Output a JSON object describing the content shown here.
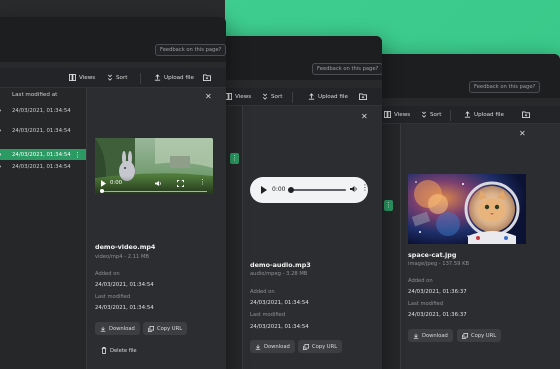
{
  "colors": {
    "accent_green": "#3ac98a",
    "selected_row": "#2b9a63",
    "window_bg": "#28292b"
  },
  "windows": [
    {
      "feedback": "Feedback on this page?",
      "toolbar": {
        "views": "Views",
        "sort": "Sort",
        "upload": "Upload file"
      },
      "list": {
        "column_header": "Last modified at",
        "rows": [
          "24/03/2021, 01:34:54",
          "24/03/2021, 01:34:54",
          "24/03/2021, 01:34:54",
          "24/03/2021, 01:34:54"
        ]
      },
      "detail": {
        "name": "demo-video.mp4",
        "meta": "video/mp4 - 2.11 MB",
        "added_label": "Added on",
        "added_value": "24/03/2021, 01:34:54",
        "modified_label": "Last modified",
        "modified_value": "24/03/2021, 01:34:54",
        "download": "Download",
        "copy_url": "Copy URL",
        "delete": "Delete file",
        "player_time": "0:00",
        "video_scene": "rabbit in forest"
      }
    },
    {
      "feedback": "Feedback on this page?",
      "toolbar": {
        "views": "Views",
        "sort": "Sort",
        "upload": "Upload file"
      },
      "detail": {
        "name": "demo-audio.mp3",
        "meta": "audio/mpeg - 3.28 MB",
        "added_label": "Added on",
        "added_value": "24/03/2021, 01:34:54",
        "modified_label": "Last modified",
        "modified_value": "24/03/2021, 01:34:54",
        "download": "Download",
        "copy_url": "Copy URL",
        "player_time": "0:00"
      }
    },
    {
      "feedback": "Feedback on this page?",
      "toolbar": {
        "views": "Views",
        "sort": "Sort",
        "upload": "Upload file"
      },
      "detail": {
        "name": "space-cat.jpg",
        "meta": "image/jpeg - 137.59 KB",
        "added_label": "Added on",
        "added_value": "24/03/2021, 01:36:37",
        "modified_label": "Last modified",
        "modified_value": "24/03/2021, 01:36:37",
        "download": "Download",
        "copy_url": "Copy URL",
        "image_scene": "cat astronaut in space"
      }
    }
  ]
}
